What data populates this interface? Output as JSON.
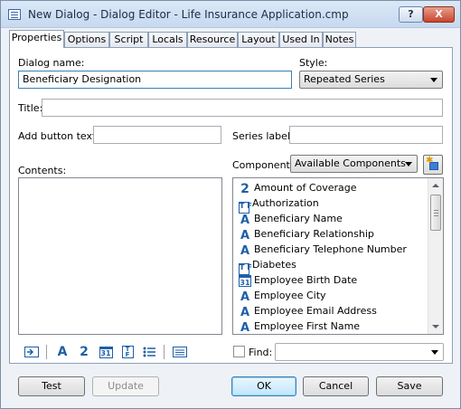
{
  "window": {
    "title": "New Dialog - Dialog Editor - Life Insurance Application.cmp",
    "help_label": "?",
    "close_label": "X"
  },
  "tabs": [
    "Properties",
    "Options",
    "Script",
    "Locals",
    "Resource",
    "Layout",
    "Used In",
    "Notes"
  ],
  "active_tab": "Properties",
  "form": {
    "dialog_name_label": "Dialog name:",
    "dialog_name_value": "Beneficiary Designation",
    "style_label": "Style:",
    "style_value": "Repeated Series",
    "title_label": "Title:",
    "title_value": "",
    "add_button_text_label": "Add button text:",
    "add_button_text_value": "",
    "series_label_label": "Series label:",
    "series_label_value": "",
    "contents_label": "Contents:",
    "components_label": "Components:",
    "components_filter": "Available Components",
    "find_label": "Find:",
    "find_value": ""
  },
  "components": [
    {
      "name": "Amount of Coverage",
      "icon": "number-icon"
    },
    {
      "name": "Authorization",
      "icon": "true-false-icon"
    },
    {
      "name": "Beneficiary Name",
      "icon": "text-icon"
    },
    {
      "name": "Beneficiary Relationship",
      "icon": "text-icon"
    },
    {
      "name": "Beneficiary Telephone Number",
      "icon": "text-icon"
    },
    {
      "name": "Diabetes",
      "icon": "true-false-icon"
    },
    {
      "name": "Employee Birth Date",
      "icon": "date-icon"
    },
    {
      "name": "Employee City",
      "icon": "text-icon"
    },
    {
      "name": "Employee Email Address",
      "icon": "text-icon"
    },
    {
      "name": "Employee First Name",
      "icon": "text-icon"
    }
  ],
  "toolbar_glyphs": {
    "text": "A",
    "number": "2",
    "date": "31",
    "true_false": "T F"
  },
  "buttons": {
    "test": "Test",
    "update": "Update",
    "ok": "OK",
    "cancel": "Cancel",
    "save": "Save"
  },
  "colors": {
    "accent": "#1f5fa8",
    "focus_border": "#3c7fb1"
  }
}
